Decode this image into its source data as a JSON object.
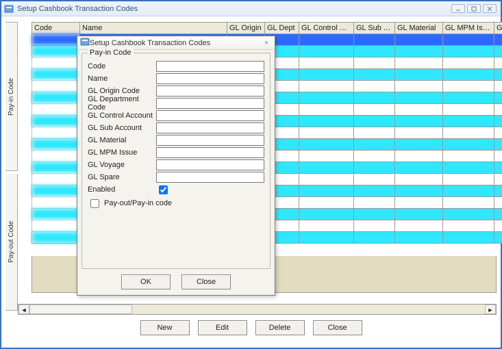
{
  "window": {
    "title": "Setup Cashbook Transaction Codes"
  },
  "tabs": {
    "payin": "Pay-in Code",
    "payout": "Pay-out Code"
  },
  "grid": {
    "headers": [
      "Code",
      "Name",
      "GL Origin",
      "GL Dept",
      "GL Control Acc",
      "GL Sub Acc",
      "GL Material",
      "GL MPM Issue",
      "GL Voyage"
    ]
  },
  "main_buttons": {
    "new": "New",
    "edit": "Edit",
    "delete": "Delete",
    "close": "Close"
  },
  "modal": {
    "title": "Setup Cashbook Transaction Codes",
    "group_legend": "Pay-in Code",
    "fields": {
      "code": "Code",
      "name": "Name",
      "gl_origin": "GL Origin Code",
      "gl_dept": "GL Department Code",
      "gl_control": "GL Control Account",
      "gl_sub": "GL Sub Account",
      "gl_material": "GL Material",
      "gl_mpm": "GL MPM Issue",
      "gl_voyage": "GL Voyage",
      "gl_spare": "GL Spare",
      "enabled": "Enabled"
    },
    "enabled_value": true,
    "payout_payin_label": "Pay-out/Pay-in code",
    "payout_payin_value": false,
    "buttons": {
      "ok": "OK",
      "close": "Close"
    }
  }
}
